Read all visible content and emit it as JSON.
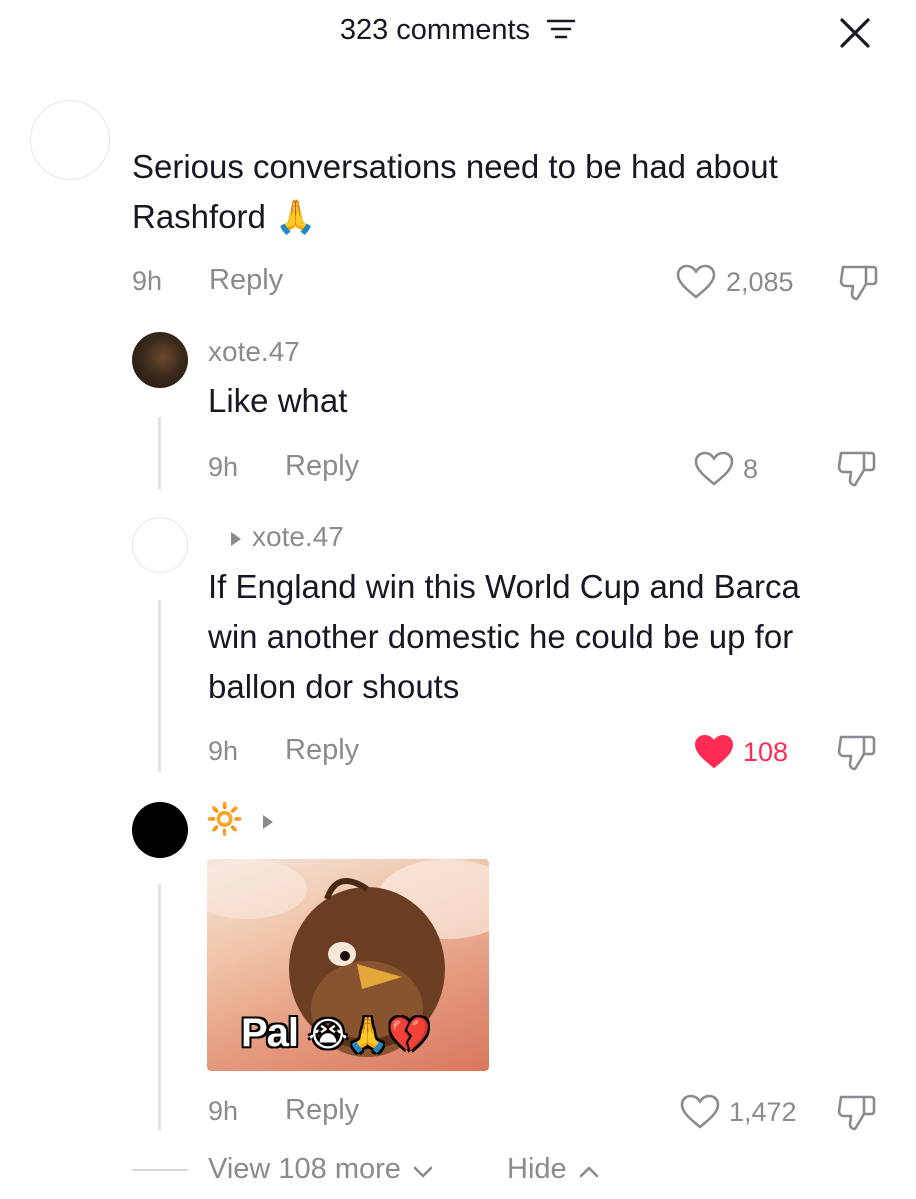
{
  "header": {
    "title": "323 comments",
    "sort_icon": "sort-lines-icon",
    "close_icon": "close-icon"
  },
  "comments": [
    {
      "text_line1": "Serious conversations need to be had about",
      "text_line2": "Rashford",
      "emoji": "🙏",
      "time": "9h",
      "reply_label": "Reply",
      "likes": "2,085",
      "liked": false
    },
    {
      "username": "xote.47",
      "text": "Like what",
      "time": "9h",
      "reply_label": "Reply",
      "likes": "8",
      "liked": false
    },
    {
      "reply_to": "xote.47",
      "text_line1": "If England win this World Cup and Barca",
      "text_line2": "win another domestic he could be up for",
      "text_line3": "ballon dor shouts",
      "time": "9h",
      "reply_label": "Reply",
      "likes": "108",
      "liked": true
    },
    {
      "username_emoji": "🔆",
      "sticker_caption": "Pal",
      "sticker_emojis": "😭🙏💔",
      "time": "9h",
      "reply_label": "Reply",
      "likes": "1,472",
      "liked": false
    }
  ],
  "footer": {
    "view_more": "View 108 more",
    "hide": "Hide"
  },
  "colors": {
    "like_red": "#fe2c55",
    "text": "#161823",
    "muted": "#8a8b91"
  }
}
